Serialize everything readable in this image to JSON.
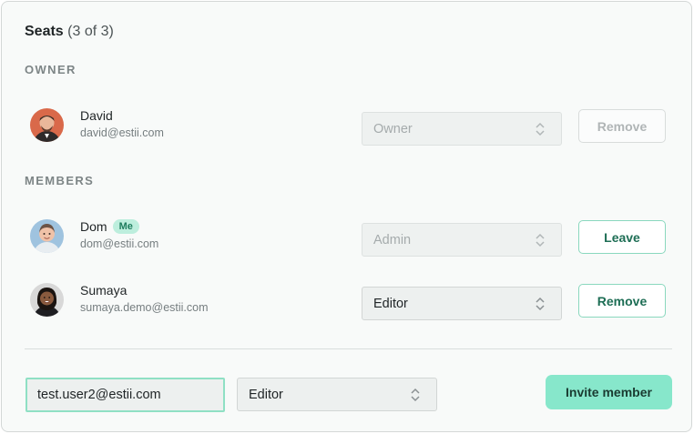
{
  "seats": {
    "title": "Seats",
    "count": "(3 of 3)"
  },
  "owner_section": {
    "label": "OWNER",
    "member": {
      "name": "David",
      "email": "david@estii.com",
      "role": "Owner",
      "action": "Remove",
      "role_disabled": true,
      "action_disabled": true
    }
  },
  "members_section": {
    "label": "MEMBERS",
    "members": [
      {
        "name": "Dom",
        "badge": "Me",
        "email": "dom@estii.com",
        "role": "Admin",
        "action": "Leave",
        "role_disabled": true,
        "action_disabled": false
      },
      {
        "name": "Sumaya",
        "email": "sumaya.demo@estii.com",
        "role": "Editor",
        "action": "Remove",
        "role_disabled": false,
        "action_disabled": false
      }
    ]
  },
  "invite": {
    "email_value": "test.user2@estii.com",
    "role": "Editor",
    "button_label": "Invite member"
  },
  "colors": {
    "accent": "#87e7cb",
    "accent_border": "#8ad8be",
    "badge_bg": "#bdeedd",
    "badge_text": "#1e7d5e"
  }
}
